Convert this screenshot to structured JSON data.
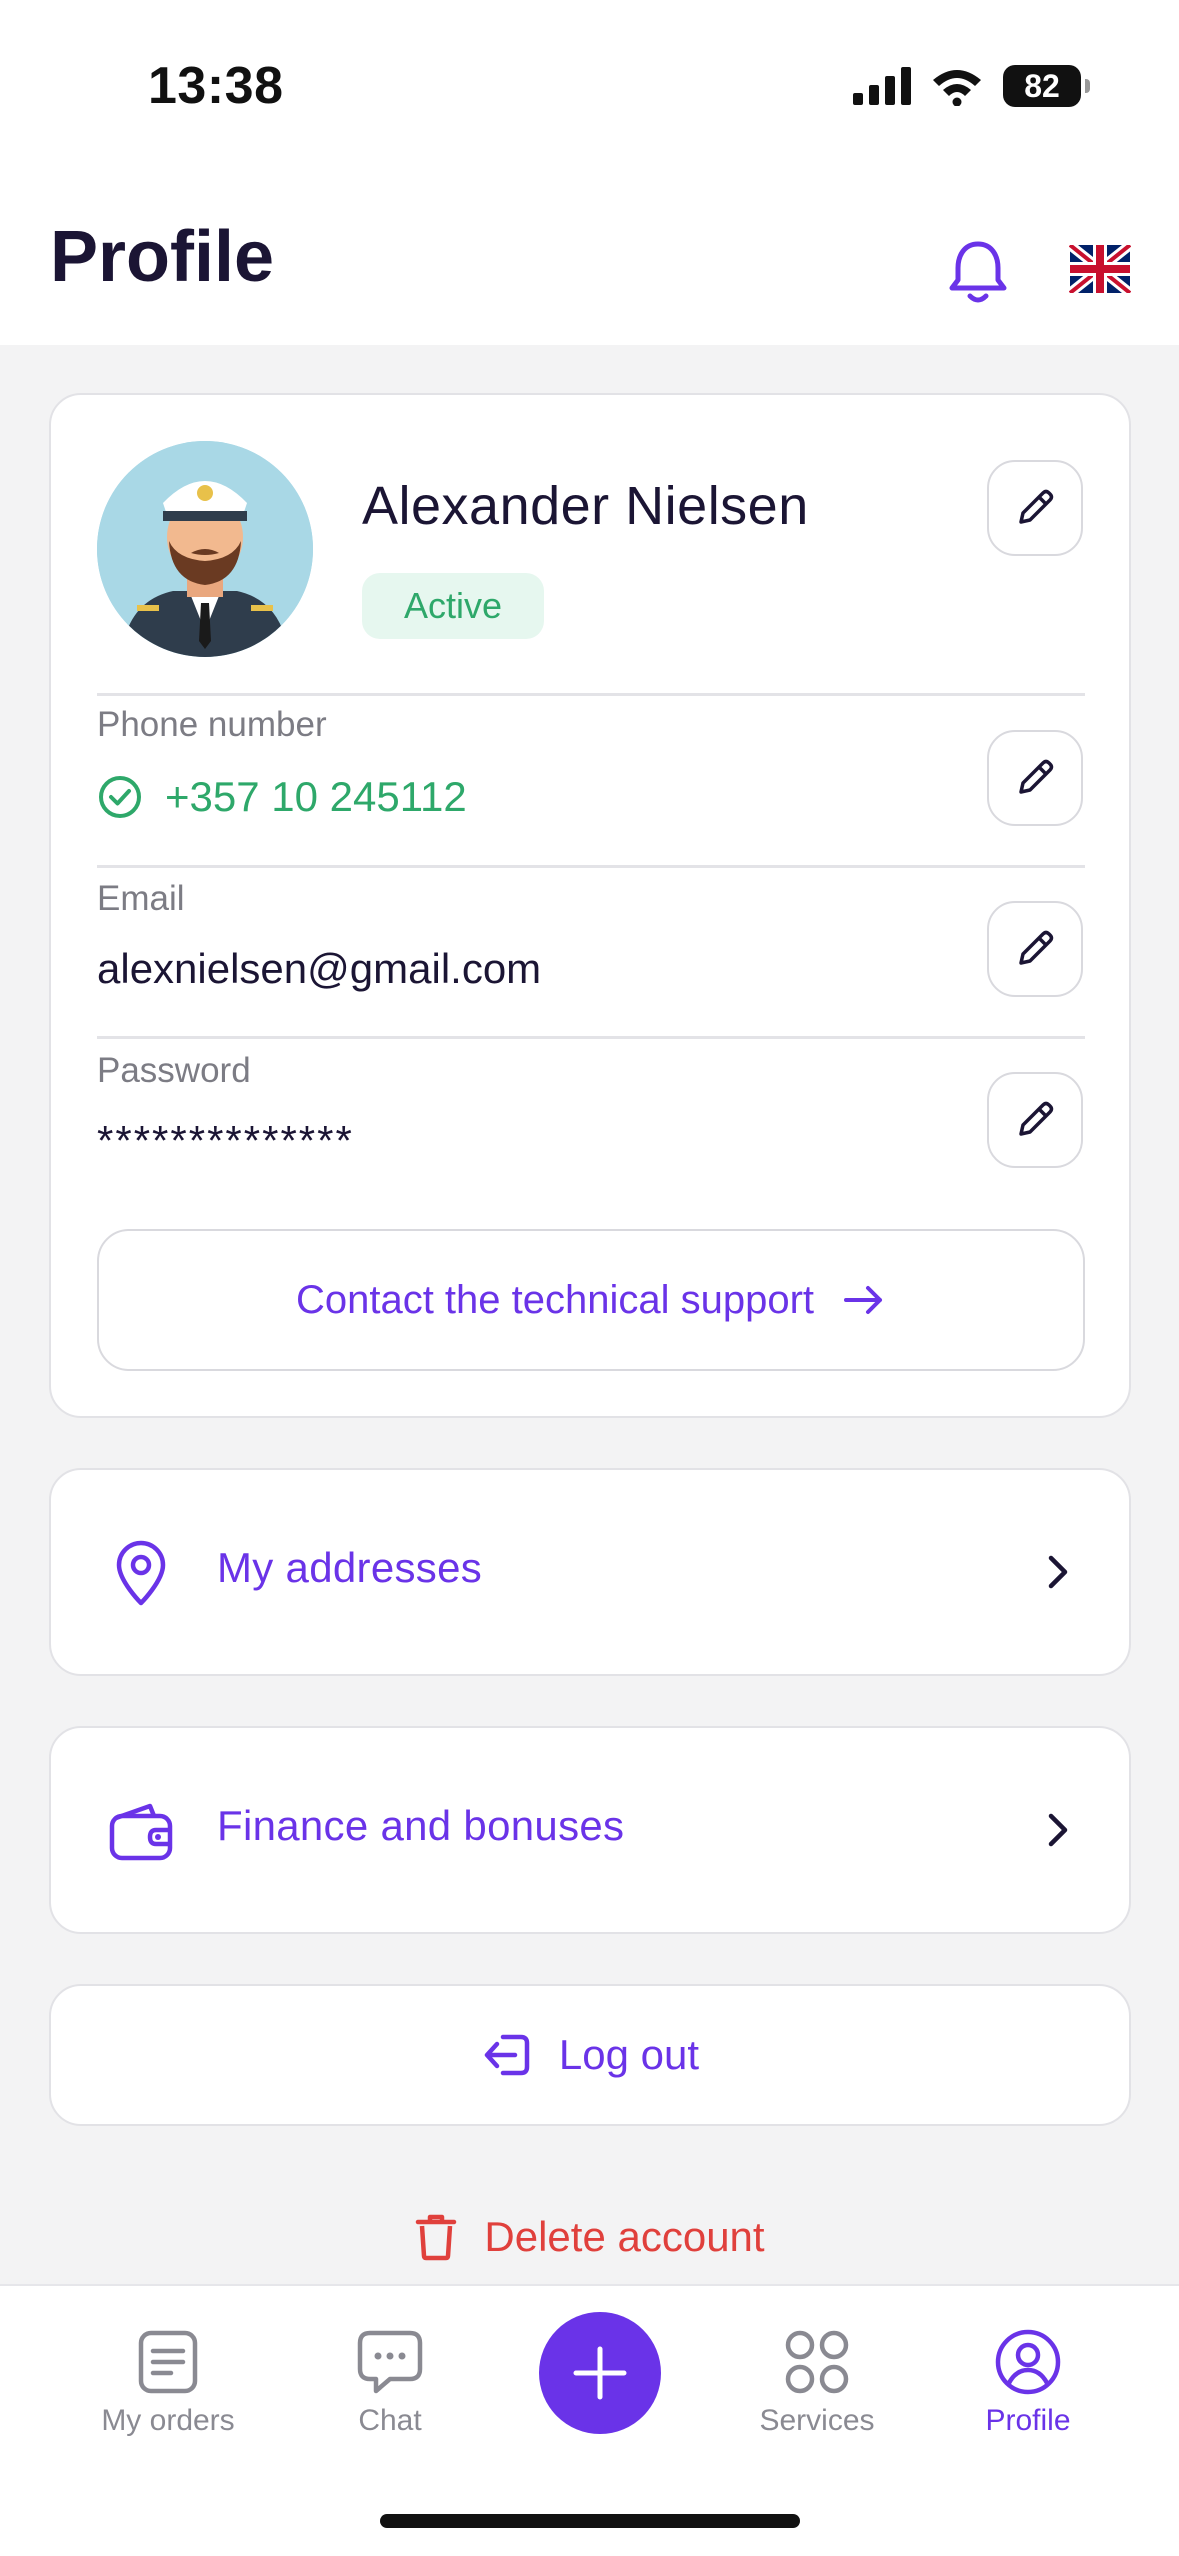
{
  "status_bar": {
    "time": "13:38",
    "battery": "82"
  },
  "header": {
    "title": "Profile"
  },
  "profile": {
    "name": "Alexander Nielsen",
    "status": "Active",
    "phone_label": "Phone number",
    "phone_value": "+357 10 245112",
    "email_label": "Email",
    "email_value": "alexnielsen@gmail.com",
    "password_label": "Password",
    "password_value": "**************",
    "support_button": "Contact the technical support"
  },
  "menu": [
    {
      "label": "My addresses",
      "icon": "location-pin-icon"
    },
    {
      "label": "Finance and bonuses",
      "icon": "wallet-icon"
    }
  ],
  "logout": {
    "label": "Log out"
  },
  "delete": {
    "label": "Delete account"
  },
  "tabbar": {
    "tabs": [
      {
        "label": "My orders",
        "icon": "orders-icon"
      },
      {
        "label": "Chat",
        "icon": "chat-icon"
      },
      {
        "label": "",
        "icon": "plus-icon"
      },
      {
        "label": "Services",
        "icon": "services-icon"
      },
      {
        "label": "Profile",
        "icon": "profile-icon"
      }
    ],
    "active": "Profile"
  },
  "colors": {
    "accent": "#6a33e8",
    "success": "#2ea86a",
    "danger": "#e0403c",
    "text": "#1b1534",
    "muted": "#7c7c84"
  }
}
